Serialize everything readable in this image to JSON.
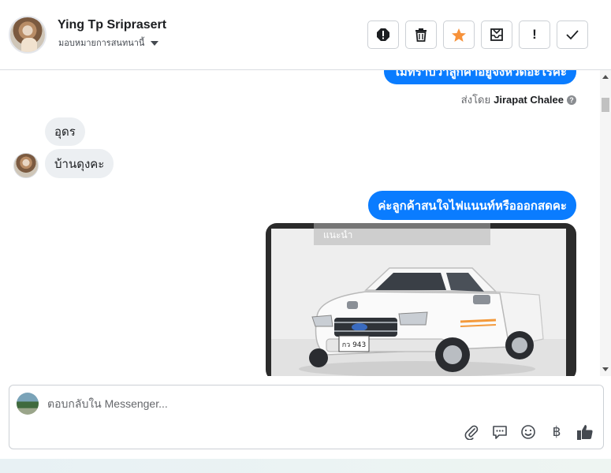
{
  "header": {
    "name": "Ying Tp Sriprasert",
    "assign_label": "มอบหมายการสนทนานี้",
    "tools": [
      {
        "icon": "report-icon",
        "label": "Report"
      },
      {
        "icon": "trash-icon",
        "label": "Delete"
      },
      {
        "icon": "star-icon",
        "label": "Star",
        "color": "#f7923a"
      },
      {
        "icon": "mark-unread-icon",
        "label": "Mark as unread"
      },
      {
        "icon": "exclamation-icon",
        "label": "!"
      },
      {
        "icon": "check-icon",
        "label": "Done"
      }
    ]
  },
  "thread": {
    "messages": [
      {
        "id": "m1",
        "direction": "out",
        "text": "ไม่ทราบว่าลูกค้าอยู่จังหวัดอะไรคะ"
      },
      {
        "id": "m2",
        "direction": "in",
        "text": "อุดร"
      },
      {
        "id": "m3",
        "direction": "in",
        "text": "บ้านดุงคะ"
      },
      {
        "id": "m4",
        "direction": "out",
        "text": "ค่ะลูกค้าสนใจไฟแนนท์หรือออกสดคะ"
      }
    ],
    "sent_by_prefix": "ส่งโดย",
    "sent_by_name": "Jirapat Chalee",
    "image_caption": "แนะนำ",
    "plate_text": "กว 943"
  },
  "composer": {
    "placeholder": "ตอบกลับใน Messenger...",
    "value": "",
    "currency_symbol": "฿"
  },
  "colors": {
    "accent": "#0a7cff",
    "incoming_bubble": "#eceff2",
    "star": "#f7923a"
  }
}
